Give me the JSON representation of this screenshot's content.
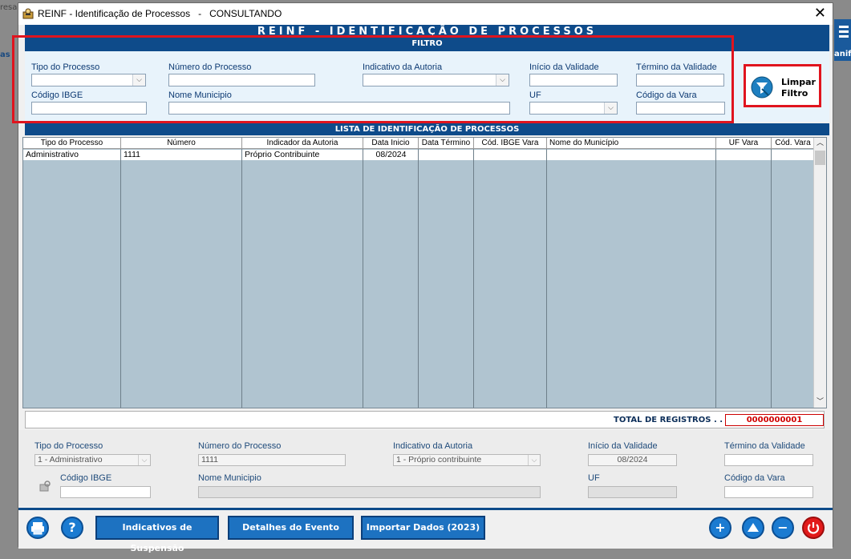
{
  "background": {
    "left_text": "resa",
    "left_text2": "as",
    "right_text": "anif"
  },
  "window": {
    "title": "REINF - Identificação de Processos   -   CONSULTANDO",
    "banner": "REINF - IDENTIFICAÇÃO DE PROCESSOS"
  },
  "filtro": {
    "header": "FILTRO",
    "tipo_processo_label": "Tipo do Processo",
    "numero_processo_label": "Número do Processo",
    "indicativo_autoria_label": "Indicativo da Autoria",
    "inicio_validade_label": "Início da Validade",
    "termino_validade_label": "Término da Validade",
    "codigo_ibge_label": "Código IBGE",
    "nome_municipio_label": "Nome Municipio",
    "uf_label": "UF",
    "codigo_vara_label": "Código da Vara",
    "limpar_line1": "Limpar",
    "limpar_line2": "Filtro"
  },
  "lista": {
    "header": "LISTA DE IDENTIFICAÇÃO DE PROCESSOS",
    "columns": [
      "Tipo do Processo",
      "Número",
      "Indicador da Autoria",
      "Data Inicio",
      "Data Término",
      "Cód. IBGE Vara",
      "Nome do Município",
      "UF Vara",
      "Cód. Vara"
    ],
    "rows": [
      [
        "Administrativo",
        "1111",
        "Próprio Contribuinte",
        "08/2024",
        "",
        "",
        "",
        "",
        ""
      ]
    ],
    "total_label": "TOTAL DE REGISTROS . . :",
    "total_value": "0000000001"
  },
  "detail": {
    "tipo_processo_label": "Tipo do Processo",
    "tipo_processo_value": "1 - Administrativo",
    "numero_processo_label": "Número do Processo",
    "numero_processo_value": "1111",
    "indicativo_autoria_label": "Indicativo da Autoria",
    "indicativo_autoria_value": "1 - Próprio contribuinte",
    "inicio_validade_label": "Início da Validade",
    "inicio_validade_value": "08/2024",
    "termino_validade_label": "Término da Validade",
    "codigo_ibge_label": "Código IBGE",
    "nome_municipio_label": "Nome Municipio",
    "uf_label": "UF",
    "codigo_vara_label": "Código da Vara"
  },
  "toolbar": {
    "indicativos_label": "Indicativos de Suspensão",
    "detalhes_label": "Detalhes do Evento",
    "importar_label": "Importar Dados (2023)"
  },
  "colors": {
    "brand": "#0e4b8a",
    "accent": "#1d72c1",
    "highlight": "#e0141e",
    "total": "#d00000"
  }
}
